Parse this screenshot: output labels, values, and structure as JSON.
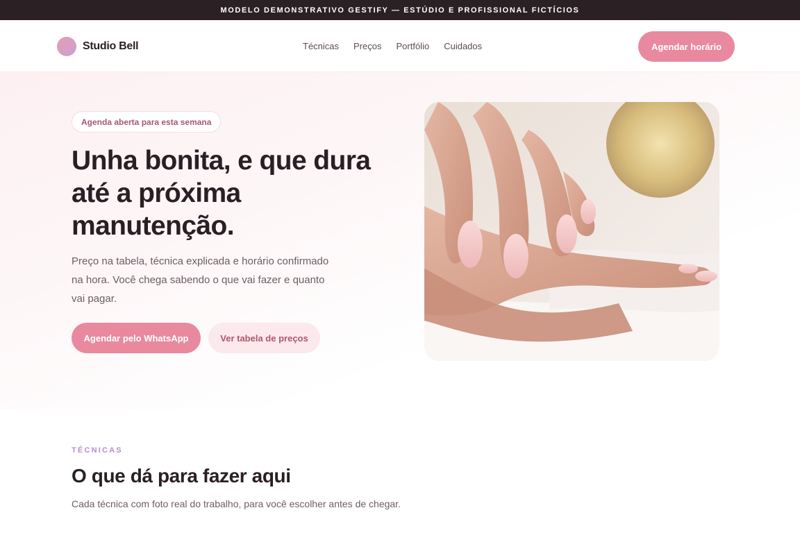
{
  "topbar": {
    "text": "MODELO DEMONSTRATIVO GESTIFY — ESTÚDIO E PROFISSIONAL FICTÍCIOS"
  },
  "nav": {
    "brand": "Studio Bell",
    "links": [
      "Técnicas",
      "Preços",
      "Portfólio",
      "Cuidados"
    ],
    "cta": "Agendar horário"
  },
  "hero": {
    "badge": "Agenda aberta para esta semana",
    "title": "Unha bonita, e que dura até a próxima manutenção.",
    "subtitle": "Preço na tabela, técnica explicada e horário confirmado na hora. Você chega sabendo o que vai fazer e quanto vai pagar.",
    "primary_button": "Agendar pelo WhatsApp",
    "secondary_button": "Ver tabela de preços",
    "photo_icon": "hands-manicure-photo"
  },
  "section": {
    "eyebrow": "TÉCNICAS",
    "title": "O que dá para fazer aqui",
    "subtitle": "Cada técnica com foto real do trabalho, para você escolher antes de chegar."
  },
  "colors": {
    "accent": "#e8899f",
    "dark": "#2b2024",
    "eyebrow": "#b48fd0"
  }
}
